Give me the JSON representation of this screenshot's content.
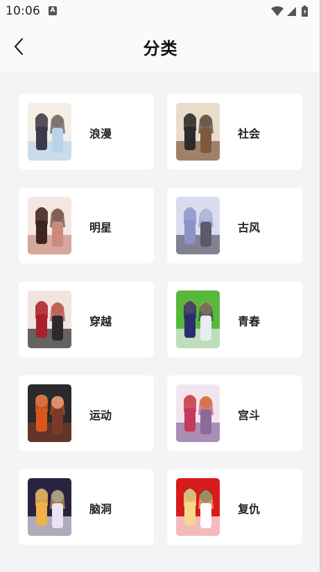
{
  "status_bar": {
    "time": "10:06",
    "notification_glyph": "A",
    "icons": [
      "wifi-icon",
      "cell-signal-icon",
      "battery-icon"
    ]
  },
  "header": {
    "title": "分类",
    "back_icon": "chevron-left-icon"
  },
  "categories": [
    {
      "label": "浪漫",
      "cover_colors": [
        "#f3eee6",
        "#3a3a4a",
        "#e8c9a0",
        "#b9d4e8"
      ]
    },
    {
      "label": "社会",
      "cover_colors": [
        "#e9dccb",
        "#2b2b2b",
        "#c8a27a",
        "#7d5a3c"
      ]
    },
    {
      "label": "明星",
      "cover_colors": [
        "#f6e6e1",
        "#3b2620",
        "#e9b7a8",
        "#c98b7d"
      ]
    },
    {
      "label": "古风",
      "cover_colors": [
        "#d9dcef",
        "#8a92c9",
        "#f1efe9",
        "#5b5a6b"
      ]
    },
    {
      "label": "穿越",
      "cover_colors": [
        "#efe4e0",
        "#a8202c",
        "#e7c79c",
        "#2b2b2b"
      ]
    },
    {
      "label": "青春",
      "cover_colors": [
        "#58b83a",
        "#2d2d6e",
        "#f4cf3a",
        "#e9ecf2"
      ]
    },
    {
      "label": "运动",
      "cover_colors": [
        "#2a2a2a",
        "#d9571d",
        "#e6e6e6",
        "#7a3a2a"
      ]
    },
    {
      "label": "宫斗",
      "cover_colors": [
        "#f2e6ee",
        "#c53a5a",
        "#f5c742",
        "#8a6a9a"
      ]
    },
    {
      "label": "脑洞",
      "cover_colors": [
        "#2a2340",
        "#f0b04a",
        "#4d7bd0",
        "#e9e4f0"
      ]
    },
    {
      "label": "复仇",
      "cover_colors": [
        "#d81b1b",
        "#f4d98a",
        "#1c1c1c",
        "#ffffff"
      ]
    }
  ]
}
